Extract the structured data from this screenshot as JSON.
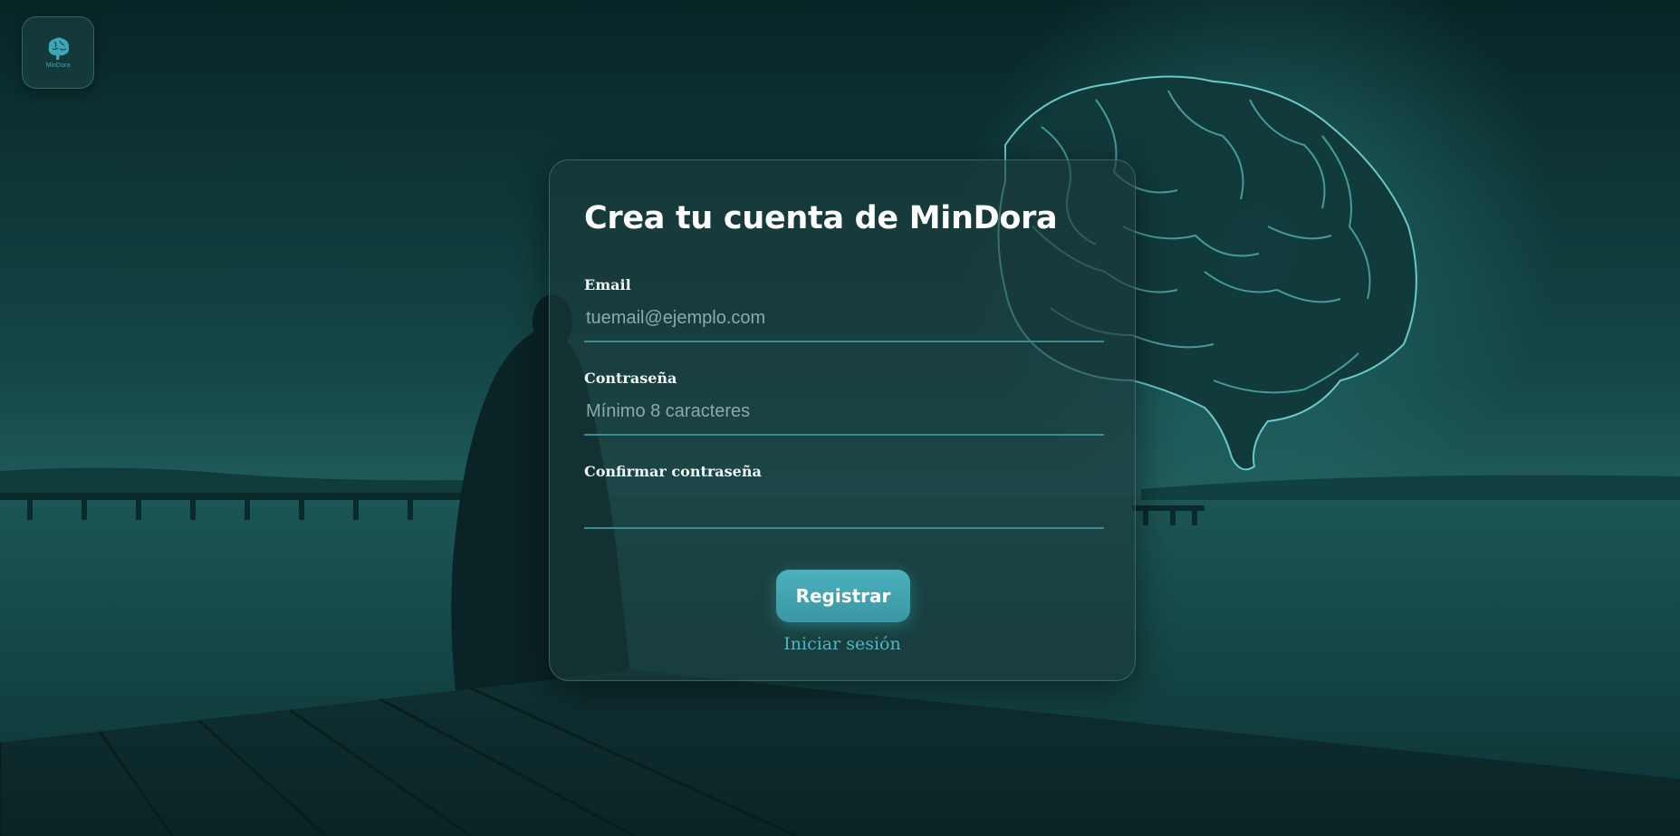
{
  "brand": {
    "logo_text": "MinDora",
    "accent_color": "#4bb1bd"
  },
  "form": {
    "title": "Crea tu cuenta de MinDora",
    "email": {
      "label": "Email",
      "placeholder": "tuemail@ejemplo.com",
      "value": ""
    },
    "password": {
      "label": "Contraseña",
      "placeholder": "Mínimo 8 caracteres",
      "value": ""
    },
    "confirm_password": {
      "label": "Confirmar contraseña",
      "placeholder": "",
      "value": ""
    },
    "submit_label": "Registrar",
    "login_link_label": "Iniciar sesión"
  },
  "background": {
    "icon": "brain-illustration",
    "scene": "person-on-pier"
  }
}
